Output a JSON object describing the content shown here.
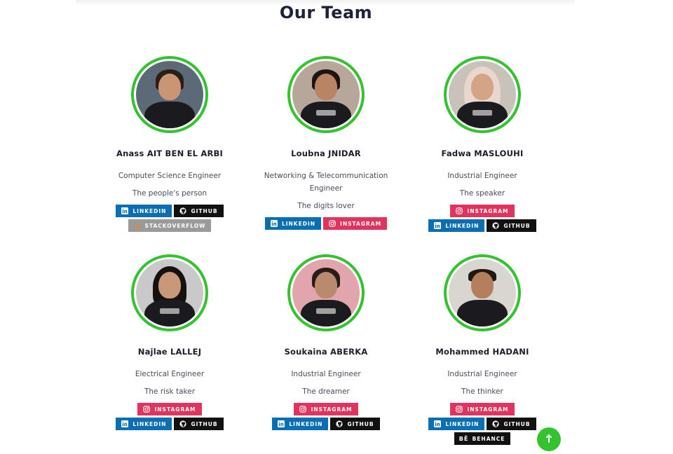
{
  "section": {
    "title": "Our Team"
  },
  "members": [
    {
      "name": "Anass AIT BEN EL ARBI",
      "role": "Computer Science Engineer",
      "tagline": "The people's person",
      "links": [
        {
          "type": "linkedin",
          "label": "LINKEDIN"
        },
        {
          "type": "github",
          "label": "GITHUB"
        },
        {
          "type": "stackoverflow",
          "label": "STACKOVERFLOW"
        }
      ],
      "skin": "#c99572",
      "hair": "#2b1e17",
      "bg": "#5c6a78"
    },
    {
      "name": "Loubna JNIDAR",
      "role": "Networking & Telecommunication Engineer",
      "tagline": "The digits lover",
      "links": [
        {
          "type": "linkedin",
          "label": "LINKEDIN"
        },
        {
          "type": "instagram",
          "label": "INSTAGRAM"
        }
      ],
      "skin": "#b98466",
      "hair": "#1e1512",
      "bg": "#b7a79a"
    },
    {
      "name": "Fadwa MASLOUHI",
      "role": "Industrial Engineer",
      "tagline": "The speaker",
      "links": [
        {
          "type": "instagram",
          "label": "INSTAGRAM"
        },
        {
          "type": "linkedin",
          "label": "LINKEDIN"
        },
        {
          "type": "github",
          "label": "GITHUB"
        }
      ],
      "skin": "#d4a487",
      "hair": "#e8d6cf",
      "bg": "#c8c2ba"
    },
    {
      "name": "Najlae LALLEJ",
      "role": "Electrical Engineer",
      "tagline": "The risk taker",
      "links": [
        {
          "type": "instagram",
          "label": "INSTAGRAM"
        },
        {
          "type": "linkedin",
          "label": "LINKEDIN"
        },
        {
          "type": "github",
          "label": "GITHUB"
        }
      ],
      "skin": "#c89878",
      "hair": "#151111",
      "bg": "#c9c9c9"
    },
    {
      "name": "Soukaina ABERKA",
      "role": "Industrial Engineer",
      "tagline": "The dreamer",
      "links": [
        {
          "type": "instagram",
          "label": "INSTAGRAM"
        },
        {
          "type": "linkedin",
          "label": "LINKEDIN"
        },
        {
          "type": "github",
          "label": "GITHUB"
        }
      ],
      "skin": "#b98a6d",
      "hair": "#2a1c16",
      "bg": "#e2a5ad"
    },
    {
      "name": "Mohammed HADANI",
      "role": "Industrial Engineer",
      "tagline": "The thinker",
      "links": [
        {
          "type": "instagram",
          "label": "INSTAGRAM"
        },
        {
          "type": "linkedin",
          "label": "LINKEDIN"
        },
        {
          "type": "github",
          "label": "GITHUB"
        },
        {
          "type": "behance",
          "label": "BEHANCE"
        }
      ],
      "skin": "#b47f5c",
      "hair": "#221812",
      "bg": "#d9d6d1"
    }
  ],
  "scroll_top": {
    "icon": "arrow-up-icon"
  }
}
